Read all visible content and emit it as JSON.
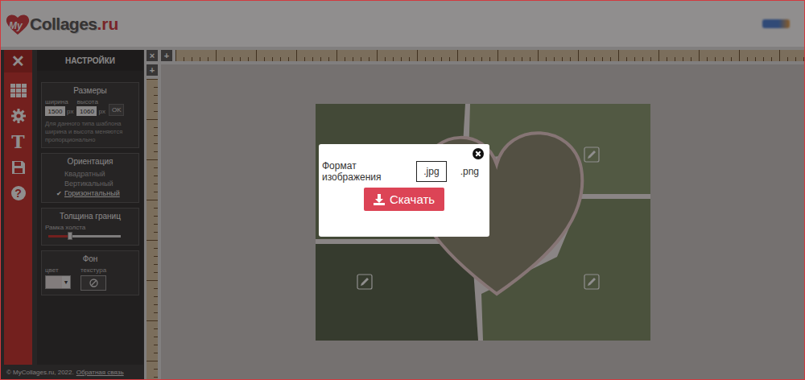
{
  "header": {
    "logo_my": "My",
    "logo_name": "Collages",
    "logo_tld": ".ru"
  },
  "toolbar": {
    "close": "✕",
    "items": [
      {
        "kind": "grid"
      },
      {
        "kind": "gear"
      },
      {
        "kind": "text",
        "glyph": "T"
      },
      {
        "kind": "save"
      },
      {
        "kind": "help",
        "glyph": "?"
      }
    ]
  },
  "settings": {
    "title": "НАСТРОЙКИ",
    "sizes": {
      "title": "Размеры",
      "width_label": "ширина",
      "height_label": "высота",
      "width": "1500",
      "width_unit": "px",
      "height": "1060",
      "height_unit": "px",
      "ok": "OK",
      "note": "Для данного типа шаблона ширина и высота меняются пропорционально"
    },
    "orientation": {
      "title": "Ориентация",
      "check": "✔",
      "options": [
        {
          "label": "Квадратный",
          "selected": false
        },
        {
          "label": "Вертикальный",
          "selected": false
        },
        {
          "label": "Горизонтальный",
          "selected": true
        }
      ]
    },
    "borders": {
      "title": "Толщина границ",
      "label": "Рамка холста",
      "level": 0.3
    },
    "background": {
      "title": "Фон",
      "color_label": "цвет",
      "color": "#e4dede",
      "arrow": "▼",
      "texture_label": "текстура"
    }
  },
  "footer": {
    "copyright": "© MyCollages.ru, 2022.",
    "feedback": "Обратная связь"
  },
  "rulers": {
    "corner_close": "×",
    "add_column": "+",
    "add_row": "+"
  },
  "dialog": {
    "format_label": "Формат изображения",
    "formats": [
      {
        "label": ".jpg",
        "selected": true
      },
      {
        "label": ".png",
        "selected": false
      }
    ],
    "download_button": "Скачать"
  }
}
